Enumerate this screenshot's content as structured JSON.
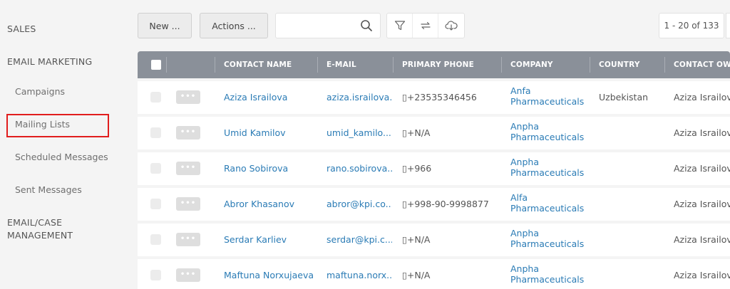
{
  "sidebar": {
    "sales": "SALES",
    "email_marketing": "EMAIL MARKETING",
    "items": [
      {
        "label": "Campaigns"
      },
      {
        "label": "Mailing Lists"
      },
      {
        "label": "Scheduled Messages"
      },
      {
        "label": "Sent Messages"
      }
    ],
    "email_case_line1": "EMAIL/CASE",
    "email_case_line2": "MANAGEMENT"
  },
  "toolbar": {
    "new_label": "New ...",
    "actions_label": "Actions ...",
    "search_value": "",
    "icons": [
      "filter-icon",
      "refresh-icon",
      "cloud-download-icon"
    ],
    "pager_label": "1 - 20 of 133"
  },
  "table": {
    "headers": [
      "CONTACT NAME",
      "E-MAIL",
      "PRIMARY PHONE",
      "COMPANY",
      "COUNTRY",
      "CONTACT OWN"
    ],
    "more_label": "•••",
    "rows": [
      {
        "name": "Aziza Israilova",
        "email": "aziza.israilova...",
        "phone": "▯+23535346456",
        "company1": "Anfa",
        "company2": "Pharmaceuticals",
        "country": "Uzbekistan",
        "owner": "Aziza Israilova"
      },
      {
        "name": "Umid Kamilov",
        "email": "umid_kamilo...",
        "phone": "▯+N/A",
        "company1": "Anpha",
        "company2": "Pharmaceuticals",
        "country": "",
        "owner": "Aziza Israilova"
      },
      {
        "name": "Rano Sobirova",
        "email": "rano.sobirova...",
        "phone": "▯+966",
        "company1": "Anpha",
        "company2": "Pharmaceuticals",
        "country": "",
        "owner": "Aziza Israilova"
      },
      {
        "name": "Abror Khasanov",
        "email": "abror@kpi.co...",
        "phone": "▯+998-90-9998877",
        "company1": "Alfa",
        "company2": "Pharmaceuticals",
        "country": "",
        "owner": "Aziza Israilova"
      },
      {
        "name": "Serdar Karliev",
        "email": "serdar@kpi.c...",
        "phone": "▯+N/A",
        "company1": "Anpha",
        "company2": "Pharmaceuticals",
        "country": "",
        "owner": "Aziza Israilova"
      },
      {
        "name": "Maftuna Norxujaeva",
        "email": "maftuna.norx...",
        "phone": "▯+N/A",
        "company1": "Anpha",
        "company2": "Pharmaceuticals",
        "country": "",
        "owner": "Aziza Israilova"
      }
    ]
  },
  "colors": {
    "header_bg": "#8a9099",
    "link": "#2a7bb5",
    "highlight": "#e11d1d"
  }
}
